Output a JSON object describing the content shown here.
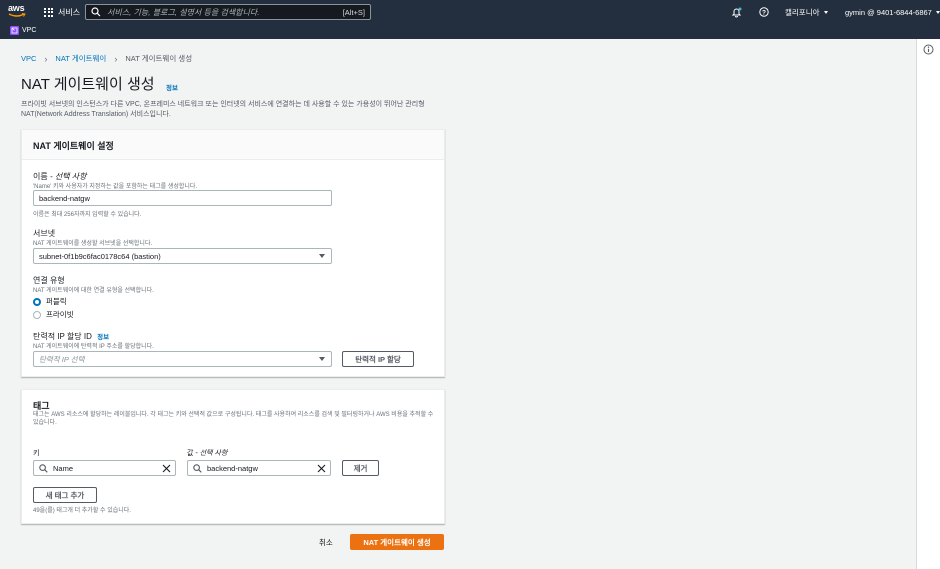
{
  "topnav": {
    "logo_text": "aws",
    "services_label": "서비스",
    "search_placeholder": "서비스, 기능, 블로그, 설명서 등을 검색합니다.",
    "search_shortcut": "[Alt+S]",
    "region_label": "캘리포니아",
    "account_label": "gymin @ 9401-6844-6867"
  },
  "subnav": {
    "favorite_label": "VPC"
  },
  "breadcrumb": {
    "root": "VPC",
    "parent": "NAT 게이트웨이",
    "current": "NAT 게이트웨이 생성"
  },
  "page": {
    "title": "NAT 게이트웨이 생성",
    "info_link": "정보",
    "description": "프라이빗 서브넷의 인스턴스가 다른 VPC, 온프레미스 네트워크 또는 인터넷의 서비스에 연결하는 데 사용할 수 있는 가용성이 뛰어난 관리형 NAT(Network Address Translation) 서비스입니다."
  },
  "settings": {
    "header": "NAT 게이트웨이 설정",
    "name_label": "이름",
    "name_optional": " - 선택 사항",
    "name_hint": "'Name' 키와 사용자가 지정하는 값을 포함하는 태그를 생성합니다.",
    "name_value": "backend-natgw",
    "name_constraint": "이름은 최대 256자까지 입력할 수 있습니다.",
    "subnet_label": "서브넷",
    "subnet_hint": "NAT 게이트웨이를 생성할 서브넷을 선택합니다.",
    "subnet_value": "subnet-0f1b9c6fac0178c64 (bastion)",
    "conn_label": "연결 유형",
    "conn_hint": "NAT 게이트웨이에 대한 연결 유형을 선택합니다.",
    "conn_public": "퍼블릭",
    "conn_private": "프라이빗",
    "eip_label": "탄력적 IP 할당 ID",
    "eip_info": "정보",
    "eip_hint": "NAT 게이트웨이에 탄력적 IP 주소를 할당합니다.",
    "eip_placeholder": "탄력적 IP 선택",
    "eip_button": "탄력적 IP 할당"
  },
  "tags": {
    "header": "태그",
    "description": "태그는 AWS 리소스에 할당하는 레이블입니다. 각 태그는 키와 선택적 값으로 구성됩니다. 태그를 사용하여 리소스를 검색 및 필터링하거나 AWS 비용을 추적할 수 있습니다.",
    "key_label": "키",
    "value_label": "값",
    "value_optional": " - 선택 사항",
    "key_value": "Name",
    "value_value": "backend-natgw",
    "remove_button": "제거",
    "add_button": "새 태그 추가",
    "remaining": "49을(를) 태그개 더 추가할 수 있습니다."
  },
  "actions": {
    "cancel": "취소",
    "submit": "NAT 게이트웨이 생성"
  },
  "colors": {
    "nav": "#232f3e",
    "link": "#0073bb",
    "primary": "#ec7211",
    "vpc_badge": "#8c4fff"
  }
}
